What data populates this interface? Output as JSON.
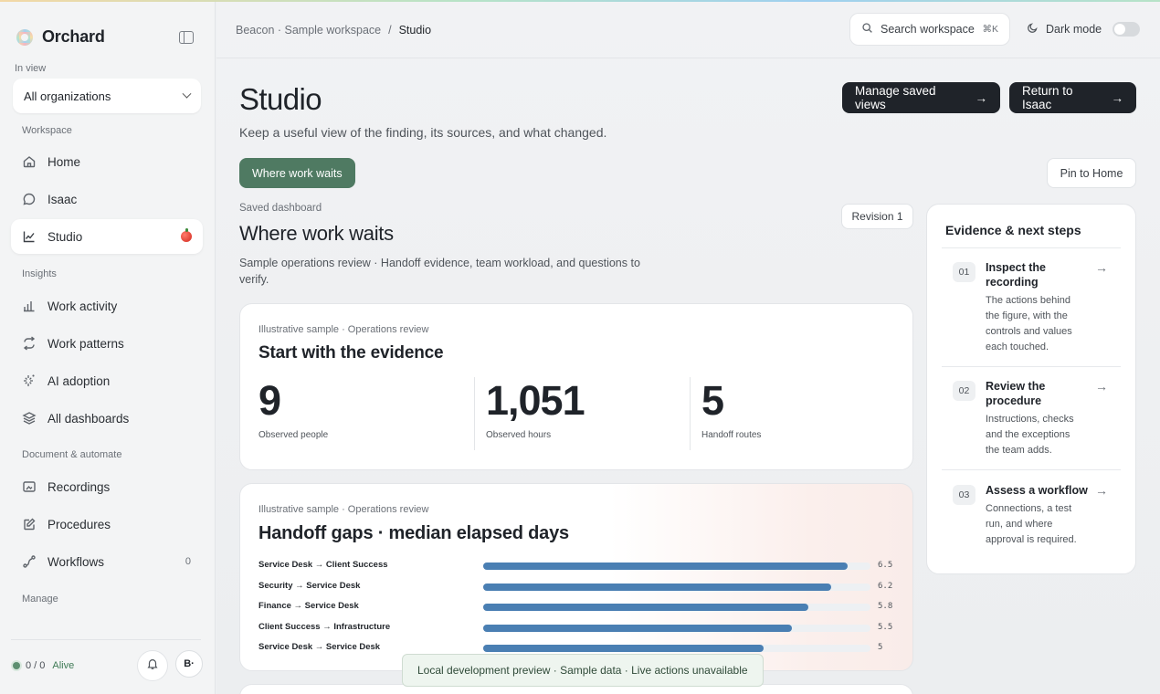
{
  "app": {
    "name": "Orchard"
  },
  "sidebar": {
    "in_view_label": "In view",
    "org_select": "All organizations",
    "sections": {
      "workspace": "Workspace",
      "insights": "Insights",
      "document": "Document & automate",
      "manage": "Manage"
    },
    "items": {
      "home": "Home",
      "isaac": "Isaac",
      "studio": "Studio",
      "work_activity": "Work activity",
      "work_patterns": "Work patterns",
      "ai_adoption": "AI adoption",
      "all_dashboards": "All dashboards",
      "recordings": "Recordings",
      "procedures": "Procedures",
      "workflows": "Workflows",
      "workflows_count": "0"
    },
    "footer": {
      "status": "0 / 0",
      "alive": "Alive",
      "avatar": "B·"
    }
  },
  "header": {
    "breadcrumb_root": "Beacon · Sample workspace",
    "breadcrumb_sep": "/",
    "breadcrumb_current": "Studio",
    "search_placeholder": "Search workspace",
    "search_shortcut": "⌘K",
    "dark_mode": "Dark mode"
  },
  "page": {
    "title": "Studio",
    "subtitle": "Keep a useful view of the finding, its sources, and what changed.",
    "manage_views": "Manage saved views",
    "return_isaac": "Return to Isaac",
    "filter_chip": "Where work waits",
    "pin_home": "Pin to Home"
  },
  "dashboard": {
    "label": "Saved dashboard",
    "title": "Where work waits",
    "revision": "Revision 1",
    "description": "Sample operations review · Handoff evidence, team workload, and questions to verify."
  },
  "evidence_card": {
    "kicker": "Illustrative sample · Operations review",
    "title": "Start with the evidence",
    "metrics": [
      {
        "value": "9",
        "label": "Observed people"
      },
      {
        "value": "1,051",
        "label": "Observed hours"
      },
      {
        "value": "5",
        "label": "Handoff routes"
      }
    ]
  },
  "handoff_card": {
    "kicker": "Illustrative sample · Operations review",
    "title": "Handoff gaps · median elapsed days",
    "bars": [
      {
        "label": "Service Desk → Client Success",
        "value": 6.5,
        "display": "6.5"
      },
      {
        "label": "Security → Service Desk",
        "value": 6.2,
        "display": "6.2"
      },
      {
        "label": "Finance → Service Desk",
        "value": 5.8,
        "display": "5.8"
      },
      {
        "label": "Client Success → Infrastructure",
        "value": 5.5,
        "display": "5.5"
      },
      {
        "label": "Service Desk → Service Desk",
        "value": 5,
        "display": "5"
      }
    ]
  },
  "next_steps": {
    "title": "Evidence & next steps",
    "steps": [
      {
        "num": "01",
        "name": "Inspect the recording",
        "desc": "The actions behind the figure, with the controls and values each touched."
      },
      {
        "num": "02",
        "name": "Review the procedure",
        "desc": "Instructions, checks and the exceptions the team adds."
      },
      {
        "num": "03",
        "name": "Assess a workflow",
        "desc": "Connections, a test run, and where approval is required."
      }
    ]
  },
  "toast": "Local development preview · Sample data · Live actions unavailable",
  "colors": {
    "accent_green": "#4f7a62",
    "bar_blue": "#4a7fb3",
    "dark_button": "#1f2329"
  }
}
